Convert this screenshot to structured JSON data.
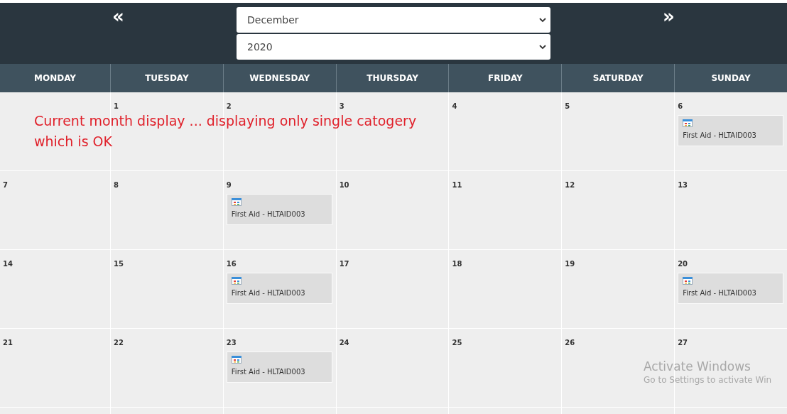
{
  "nav": {
    "prev": "«",
    "next": "»",
    "month": "December",
    "year": "2020"
  },
  "weekdays": [
    "MONDAY",
    "TUESDAY",
    "WEDNESDAY",
    "THURSDAY",
    "FRIDAY",
    "SATURDAY",
    "SUNDAY"
  ],
  "weeks": [
    [
      {
        "kind": "blank"
      },
      {
        "kind": "date",
        "day": "1"
      },
      {
        "kind": "date",
        "day": "2"
      },
      {
        "kind": "date",
        "day": "3"
      },
      {
        "kind": "date",
        "day": "4"
      },
      {
        "kind": "date",
        "day": "5"
      },
      {
        "kind": "date",
        "day": "6",
        "events": [
          "First Aid - HLTAID003"
        ]
      }
    ],
    [
      {
        "kind": "date",
        "day": "7"
      },
      {
        "kind": "date",
        "day": "8"
      },
      {
        "kind": "date",
        "day": "9",
        "events": [
          "First Aid - HLTAID003"
        ]
      },
      {
        "kind": "date",
        "day": "10"
      },
      {
        "kind": "date",
        "day": "11"
      },
      {
        "kind": "date",
        "day": "12"
      },
      {
        "kind": "date",
        "day": "13"
      }
    ],
    [
      {
        "kind": "date",
        "day": "14"
      },
      {
        "kind": "date",
        "day": "15"
      },
      {
        "kind": "date",
        "day": "16",
        "events": [
          "First Aid - HLTAID003"
        ]
      },
      {
        "kind": "date",
        "day": "17"
      },
      {
        "kind": "date",
        "day": "18"
      },
      {
        "kind": "date",
        "day": "19"
      },
      {
        "kind": "date",
        "day": "20",
        "events": [
          "First Aid - HLTAID003"
        ]
      }
    ],
    [
      {
        "kind": "date",
        "day": "21"
      },
      {
        "kind": "date",
        "day": "22"
      },
      {
        "kind": "date",
        "day": "23",
        "events": [
          "First Aid - HLTAID003"
        ]
      },
      {
        "kind": "date",
        "day": "24"
      },
      {
        "kind": "date",
        "day": "25"
      },
      {
        "kind": "date",
        "day": "26"
      },
      {
        "kind": "date",
        "day": "27"
      }
    ],
    [
      {
        "kind": "blank"
      },
      {
        "kind": "blank"
      },
      {
        "kind": "blank"
      },
      {
        "kind": "blank"
      },
      {
        "kind": "blank"
      },
      {
        "kind": "blank"
      },
      {
        "kind": "blank"
      }
    ]
  ],
  "annotation": {
    "lines": [
      "Current month display ... displaying only single catogery",
      "which is OK"
    ]
  },
  "os_notice": {
    "title": "Activate Windows",
    "subtitle": "Go to Settings to activate Win"
  }
}
